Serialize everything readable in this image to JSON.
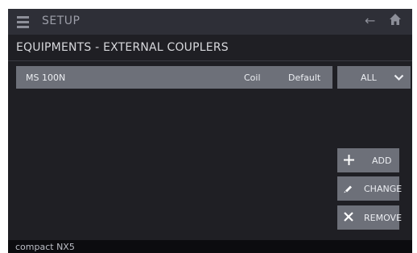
{
  "header": {
    "title": "SETUP"
  },
  "section": {
    "title": "EQUIPMENTS - EXTERNAL COUPLERS"
  },
  "couplers": [
    {
      "name": "MS 100N",
      "type": "Coil",
      "setting": "Default"
    }
  ],
  "filter": {
    "selected": "ALL"
  },
  "actions": {
    "add": "ADD",
    "change": "CHANGE",
    "remove": "REMOVE"
  },
  "footer": {
    "device": "compact NX5"
  },
  "icons": {
    "menu": "menu-icon",
    "back": "back-arrow-icon",
    "home": "home-icon",
    "dropdown": "chevron-down-icon",
    "add": "plus-icon",
    "change": "pencil-icon",
    "remove": "close-icon"
  },
  "colors": {
    "background": "#1f1f24",
    "topbar": "#2e2f37",
    "row": "#6d7079",
    "footer": "#0c0c0f",
    "text": "#eceef2"
  }
}
